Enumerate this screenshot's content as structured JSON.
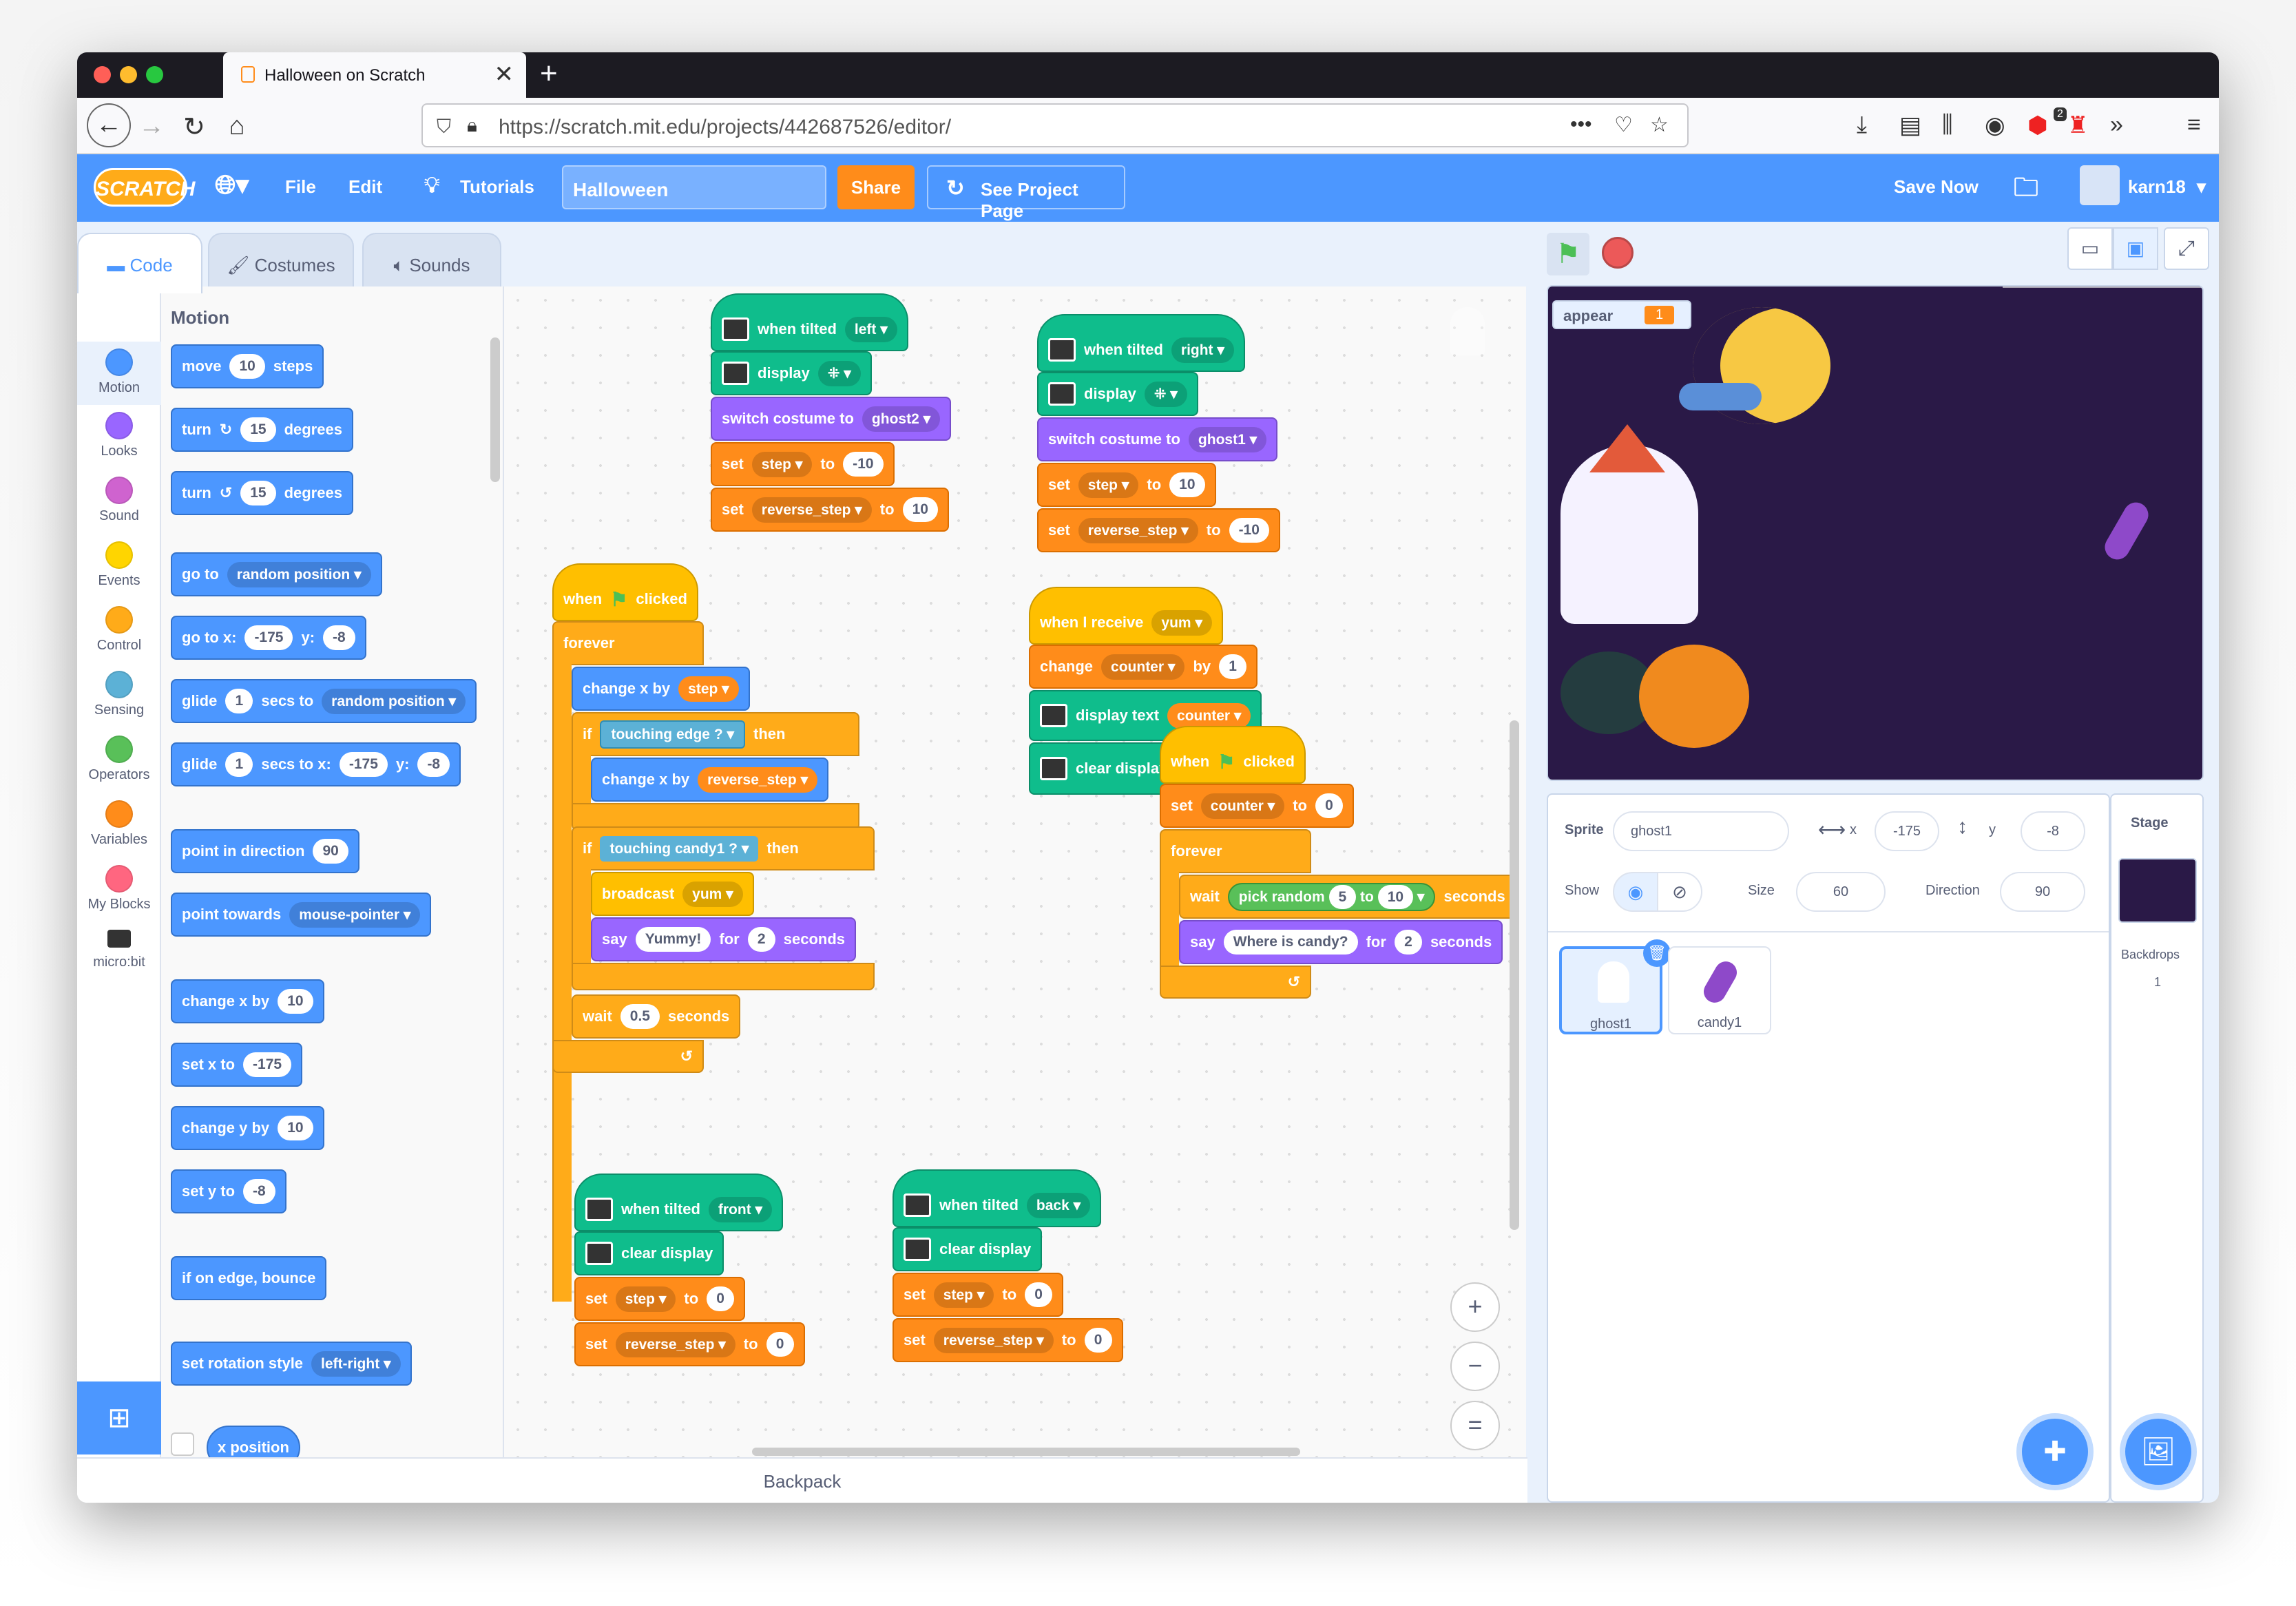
{
  "browser": {
    "tab_title": "Halloween on Scratch",
    "url": "https://scratch.mit.edu/projects/442687526/editor/",
    "new_tab_symbol": "+",
    "close_tab_symbol": "✕",
    "menu_symbol": "•••",
    "badge_count": "2"
  },
  "scratch_menu": {
    "logo": "SCRATCH",
    "file": "File",
    "edit": "Edit",
    "tutorials": "Tutorials",
    "project_title": "Halloween",
    "share": "Share",
    "see_project_page": "See Project Page",
    "save_now": "Save Now",
    "username": "karn18"
  },
  "editor_tabs": {
    "code": "Code",
    "costumes": "Costumes",
    "sounds": "Sounds"
  },
  "categories": [
    {
      "label": "Motion",
      "color": "#4c97ff"
    },
    {
      "label": "Looks",
      "color": "#9966ff"
    },
    {
      "label": "Sound",
      "color": "#cf63cf"
    },
    {
      "label": "Events",
      "color": "#ffd500"
    },
    {
      "label": "Control",
      "color": "#ffab19"
    },
    {
      "label": "Sensing",
      "color": "#5cb1d6"
    },
    {
      "label": "Operators",
      "color": "#59c059"
    },
    {
      "label": "Variables",
      "color": "#ff8c1a"
    },
    {
      "label": "My Blocks",
      "color": "#ff6680"
    },
    {
      "label": "micro:bit",
      "color": "#0fbd8c"
    }
  ],
  "palette": {
    "heading": "Motion",
    "move": {
      "a": "move",
      "v": "10",
      "b": "steps"
    },
    "turn_r": {
      "a": "turn",
      "v": "15",
      "b": "degrees"
    },
    "turn_l": {
      "a": "turn",
      "v": "15",
      "b": "degrees"
    },
    "goto": {
      "a": "go to",
      "v": "random position"
    },
    "gotoxy": {
      "a": "go to x:",
      "x": "-175",
      "b": "y:",
      "y": "-8"
    },
    "glide1": {
      "a": "glide",
      "v": "1",
      "b": "secs to",
      "c": "random position"
    },
    "glide2": {
      "a": "glide",
      "v": "1",
      "b": "secs to x:",
      "x": "-175",
      "c": "y:",
      "y": "-8"
    },
    "point_dir": {
      "a": "point in direction",
      "v": "90"
    },
    "point_towards": {
      "a": "point towards",
      "v": "mouse-pointer"
    },
    "change_x": {
      "a": "change x by",
      "v": "10"
    },
    "set_x": {
      "a": "set x to",
      "v": "-175"
    },
    "change_y": {
      "a": "change y by",
      "v": "10"
    },
    "set_y": {
      "a": "set y to",
      "v": "-8"
    },
    "bounce": "if on edge, bounce",
    "rot": {
      "a": "set rotation style",
      "v": "left-right"
    },
    "xpos": "x position"
  },
  "scripts": {
    "s1": {
      "hat": "when tilted",
      "hat_v": "left",
      "display": "display",
      "costume": "switch costume to",
      "costume_v": "ghost2",
      "set": "set",
      "var1": "step",
      "to": "to",
      "v1": "-10",
      "var2": "reverse_step",
      "v2": "10"
    },
    "s2": {
      "hat": "when tilted",
      "hat_v": "right",
      "display": "display",
      "costume": "switch costume to",
      "costume_v": "ghost1",
      "set": "set",
      "var1": "step",
      "to": "to",
      "v1": "10",
      "var2": "reverse_step",
      "v2": "-10"
    },
    "s3": {
      "when": "when",
      "clicked": "clicked",
      "forever": "forever",
      "change_x": "change x by",
      "step": "step",
      "if": "if",
      "touching": "touching",
      "edge": "edge",
      "q": "?",
      "then": "then",
      "reverse_step": "reverse_step",
      "candy": "candy1",
      "broadcast": "broadcast",
      "yum": "yum",
      "say": "say",
      "yummy": "Yummy!",
      "for": "for",
      "secs_v": "2",
      "seconds": "seconds",
      "wait": "wait",
      "wait_v": "0.5"
    },
    "s4": {
      "hat": "when I receive",
      "hat_v": "yum",
      "change": "change",
      "var": "counter",
      "by": "by",
      "v": "1",
      "display_text": "display text",
      "counter": "counter",
      "clear": "clear display"
    },
    "s5": {
      "when": "when",
      "clicked": "clicked",
      "set": "set",
      "var": "counter",
      "to": "to",
      "v": "0",
      "forever": "forever",
      "wait": "wait",
      "pick": "pick random",
      "a": "5",
      "b": "10",
      "seconds": "seconds",
      "say": "say",
      "msg": "Where is candy?",
      "for": "for",
      "secs_v": "2"
    },
    "s6": {
      "hat": "when tilted",
      "hat_v": "front",
      "clear": "clear display",
      "set": "set",
      "var1": "step",
      "to": "to",
      "v1": "0",
      "var2": "reverse_step",
      "v2": "0"
    },
    "s7": {
      "hat": "when tilted",
      "hat_v": "back",
      "clear": "clear display",
      "set": "set",
      "var1": "step",
      "to": "to",
      "v1": "0",
      "var2": "reverse_step",
      "v2": "0"
    }
  },
  "backpack": "Backpack",
  "stage": {
    "monitor_label": "appear",
    "monitor_value": "1"
  },
  "sprite_info": {
    "sprite_label": "Sprite",
    "sprite_name": "ghost1",
    "x_label": "x",
    "x": "-175",
    "y_label": "y",
    "y": "-8",
    "show_label": "Show",
    "size_label": "Size",
    "size": "60",
    "direction_label": "Direction",
    "direction": "90"
  },
  "sprites": [
    "ghost1",
    "candy1"
  ],
  "stage_panel": {
    "title": "Stage",
    "backdrops_label": "Backdrops",
    "backdrops_count": "1"
  },
  "zoom": {
    "in": "+",
    "out": "−",
    "reset": "="
  }
}
